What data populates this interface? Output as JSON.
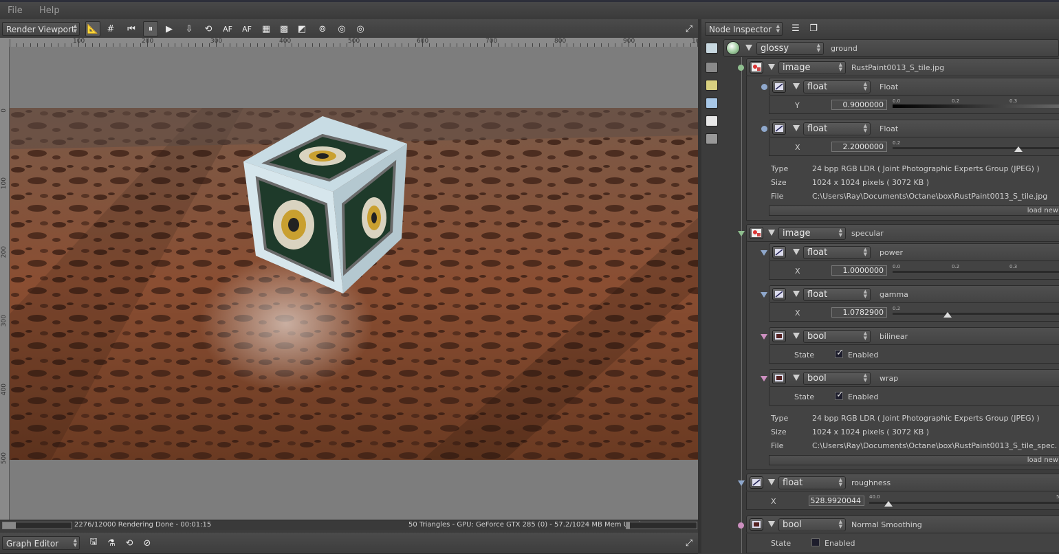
{
  "menu": [
    "File",
    "Help"
  ],
  "viewport_toolbar": {
    "mode": "Render Viewport",
    "buttons": [
      {
        "name": "ruler-icon",
        "glyph": "📐",
        "active": true
      },
      {
        "name": "grid-icon",
        "glyph": "#",
        "active": false
      },
      {
        "name": "restart-icon",
        "glyph": "⏮",
        "active": false
      },
      {
        "name": "pause-icon",
        "glyph": "⏸",
        "active": true
      },
      {
        "name": "play-icon",
        "glyph": "▶",
        "active": false
      },
      {
        "name": "export-icon",
        "glyph": "⇩",
        "active": false
      },
      {
        "name": "camera-reset-icon",
        "glyph": "⟲",
        "active": false
      },
      {
        "name": "autofocus-icon",
        "glyph": "AF",
        "active": false
      },
      {
        "name": "focus-picker-icon",
        "glyph": "AF",
        "active": false
      },
      {
        "name": "region-icon",
        "glyph": "▦",
        "active": false
      },
      {
        "name": "checker-icon",
        "glyph": "▩",
        "active": false
      },
      {
        "name": "alpha-icon",
        "glyph": "◩",
        "active": false
      },
      {
        "name": "stereo-icon",
        "glyph": "⊚",
        "active": false
      },
      {
        "name": "world-lock-icon",
        "glyph": "◎",
        "active": false
      },
      {
        "name": "world-unlock-icon",
        "glyph": "◎",
        "active": false
      }
    ],
    "fullscreen_icon": "⤢"
  },
  "ruler": {
    "top_labels": [
      "100",
      "200",
      "300",
      "400",
      "500",
      "600",
      "700",
      "800",
      "900",
      "10"
    ],
    "left_labels": [
      "0",
      "100",
      "200",
      "300",
      "400",
      "500"
    ]
  },
  "status": {
    "progress": 0.19,
    "left": "2276/12000 Rendering Done - 00:01:15",
    "right": "50 Triangles - GPU: GeForce GTX 285 (0) - 57.2/1024 MB Mem Used"
  },
  "graph_editor": {
    "label": "Graph Editor"
  },
  "inspector": {
    "title": "Node Inspector",
    "root": {
      "type": "glossy",
      "name": "ground"
    },
    "diffuse_image": {
      "type": "image",
      "name": "RustPaint0013_S_tile.jpg",
      "gamma": {
        "type": "float",
        "name": "Float",
        "axis": "Y",
        "value": "0.9000000",
        "ticks": [
          "0.0",
          "0.2",
          "0.3"
        ],
        "level": 0.0
      },
      "power": {
        "type": "float",
        "name": "Float",
        "axis": "X",
        "value": "2.2000000",
        "ticks": [
          "0.2"
        ],
        "level": 0.75
      },
      "info": {
        "type_label": "Type",
        "type_value": "24 bpp RGB LDR ( Joint Photographic Experts Group (JPEG) )",
        "size_label": "Size",
        "size_value": "1024 x 1024 pixels ( 3072 KB )",
        "file_label": "File",
        "file_value": "C:\\Users\\Ray\\Documents\\Octane\\box\\RustPaint0013_S_tile.jpg"
      },
      "load_label": "load new"
    },
    "specular_image": {
      "type": "image",
      "name": "specular",
      "power": {
        "type": "float",
        "name": "power",
        "axis": "X",
        "value": "1.0000000",
        "ticks": [
          "0.0",
          "0.2",
          "0.3"
        ],
        "level": 0.0
      },
      "gamma": {
        "type": "float",
        "name": "gamma",
        "axis": "X",
        "value": "1.0782900",
        "ticks": [
          "0.2"
        ],
        "level": 0.35
      },
      "bilinear": {
        "type": "bool",
        "name": "bilinear",
        "state_label": "State",
        "enabled_label": "Enabled",
        "checked": true
      },
      "wrap": {
        "type": "bool",
        "name": "wrap",
        "state_label": "State",
        "enabled_label": "Enabled",
        "checked": true
      },
      "info": {
        "type_label": "Type",
        "type_value": "24 bpp RGB LDR ( Joint Photographic Experts Group (JPEG) )",
        "size_label": "Size",
        "size_value": "1024 x 1024 pixels ( 3072 KB )",
        "file_label": "File",
        "file_value": "C:\\Users\\Ray\\Documents\\Octane\\box\\RustPaint0013_S_tile_spec."
      },
      "load_label": "load new"
    },
    "roughness": {
      "type": "float",
      "name": "roughness",
      "axis": "X",
      "value": "528.9920044",
      "ticks": [
        "40.0",
        "5"
      ],
      "level": 0.05
    },
    "normal_smoothing": {
      "type": "bool",
      "name": "Normal Smoothing",
      "state_label": "State",
      "enabled_label": "Enabled",
      "checked": false
    }
  },
  "colors": {
    "accent_pin_green": "#8fbf8f",
    "pin_blue": "#8fa8cc",
    "pin_pink": "#cc8fbf"
  }
}
